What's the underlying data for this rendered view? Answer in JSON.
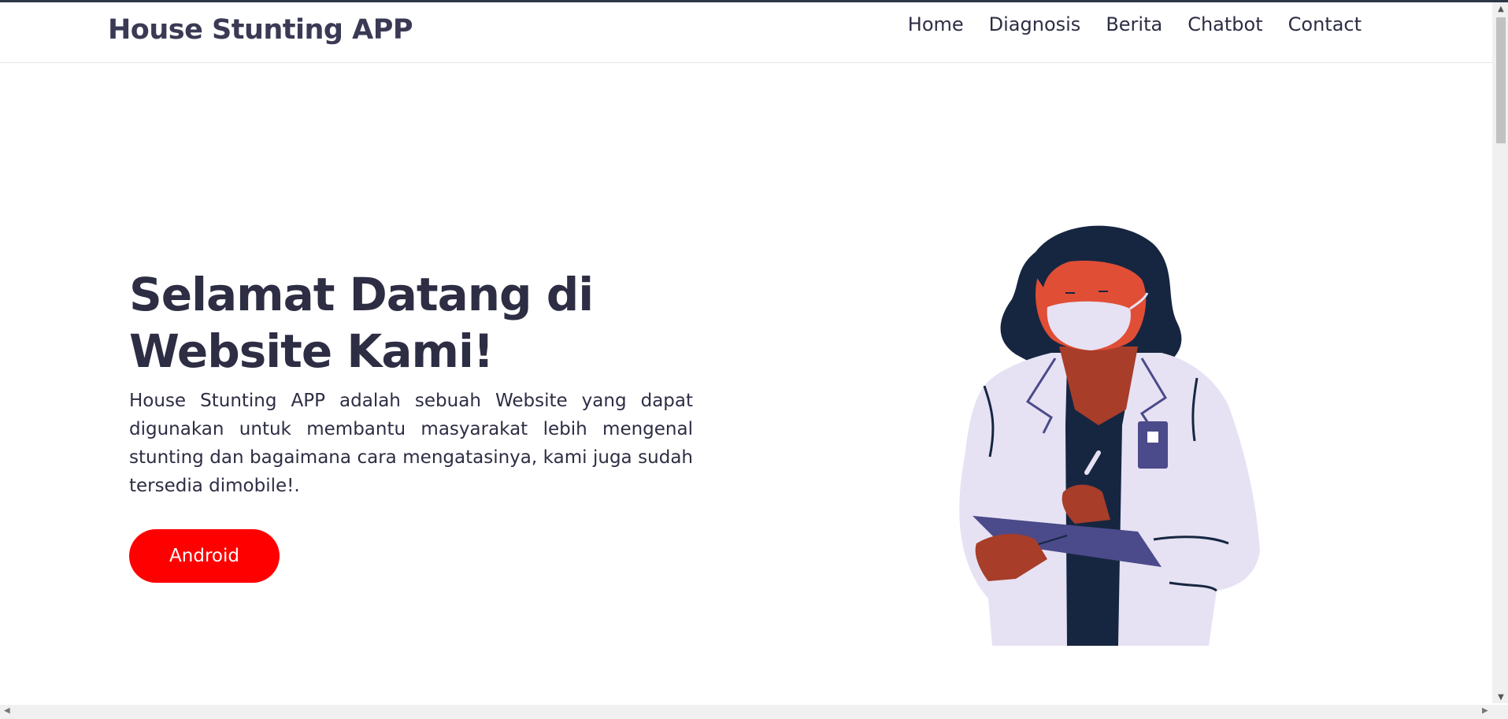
{
  "brand": "House Stunting APP",
  "nav": {
    "items": [
      {
        "label": "Home"
      },
      {
        "label": "Diagnosis"
      },
      {
        "label": "Berita"
      },
      {
        "label": "Chatbot"
      },
      {
        "label": "Contact"
      }
    ]
  },
  "hero": {
    "title": "Selamat Datang di Website Kami!",
    "description": "House Stunting APP adalah sebuah Website yang dapat digunakan untuk membantu masyarakat lebih mengenal stunting dan bagaimana cara mengatasinya, kami juga sudah tersedia dimobile!.",
    "button_label": "Android"
  },
  "colors": {
    "accent": "#ff0000",
    "text": "#2d2d44",
    "coat": "#e6e2f3",
    "hair": "#162641",
    "skin": "#e04e35",
    "clipboard": "#4b4a8a"
  },
  "icons": {
    "illustration": "doctor-woman-with-clipboard"
  }
}
